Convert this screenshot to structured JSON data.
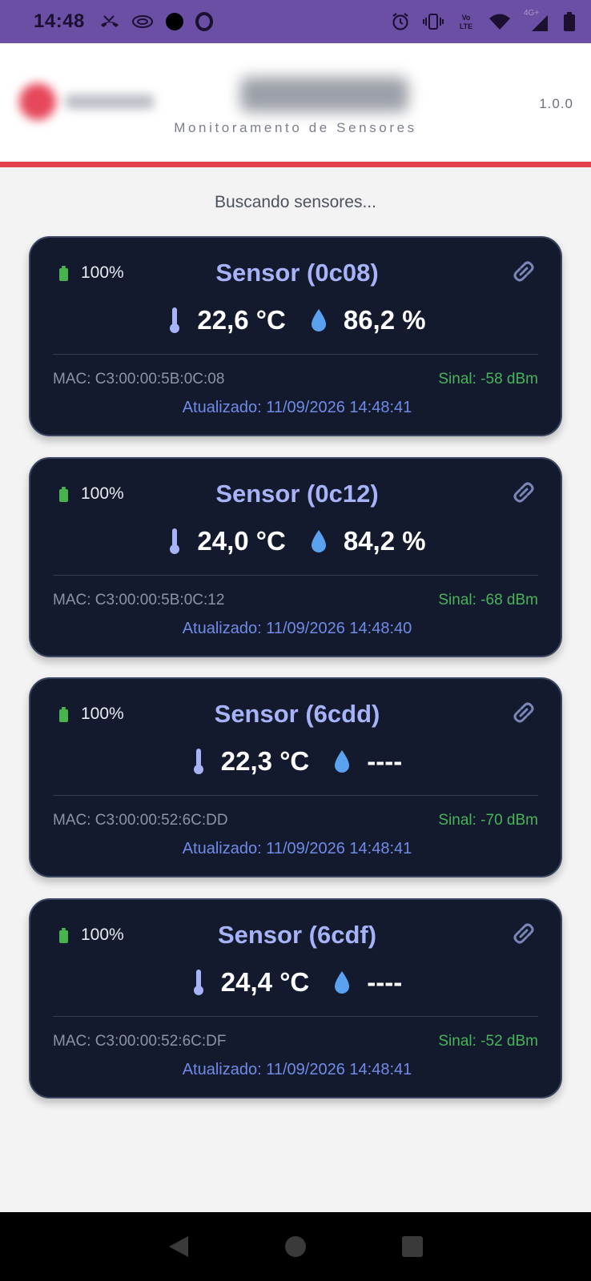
{
  "status_bar": {
    "time": "14:48",
    "left_icons": [
      "missed-call-icon",
      "cast-icon",
      "record-dot-icon",
      "opera-icon"
    ],
    "right_icons": [
      "alarm-icon",
      "vibrate-icon",
      "volte-icon",
      "wifi-icon",
      "cellular-4g-icon",
      "battery-icon"
    ],
    "network_label": "4G+"
  },
  "header": {
    "subtitle": "Monitoramento de Sensores",
    "version": "1.0.0",
    "accent_color": "#e3424f"
  },
  "scan_status": "Buscando sensores...",
  "sensors": [
    {
      "battery": "100%",
      "name": "Sensor (0c08)",
      "temperature": "22,6 °C",
      "humidity": "86,2 %",
      "mac": "MAC: C3:00:00:5B:0C:08",
      "signal": "Sinal: -58 dBm",
      "updated": "Atualizado: 11/09/2026 14:48:41"
    },
    {
      "battery": "100%",
      "name": "Sensor (0c12)",
      "temperature": "24,0 °C",
      "humidity": "84,2 %",
      "mac": "MAC: C3:00:00:5B:0C:12",
      "signal": "Sinal: -68 dBm",
      "updated": "Atualizado: 11/09/2026 14:48:40"
    },
    {
      "battery": "100%",
      "name": "Sensor (6cdd)",
      "temperature": "22,3 °C",
      "humidity": "----",
      "mac": "MAC: C3:00:00:52:6C:DD",
      "signal": "Sinal: -70 dBm",
      "updated": "Atualizado: 11/09/2026 14:48:41"
    },
    {
      "battery": "100%",
      "name": "Sensor (6cdf)",
      "temperature": "24,4 °C",
      "humidity": "----",
      "mac": "MAC: C3:00:00:52:6C:DF",
      "signal": "Sinal: -52 dBm",
      "updated": "Atualizado: 11/09/2026 14:48:41"
    }
  ],
  "colors": {
    "card_bg": "#141a2e",
    "sensor_name": "#a6b3f8",
    "signal_green": "#45b45a",
    "updated_blue": "#6f8be6",
    "battery_green": "#48b34f"
  },
  "nav": {
    "icons": [
      "back-icon",
      "home-icon",
      "recents-icon"
    ]
  }
}
